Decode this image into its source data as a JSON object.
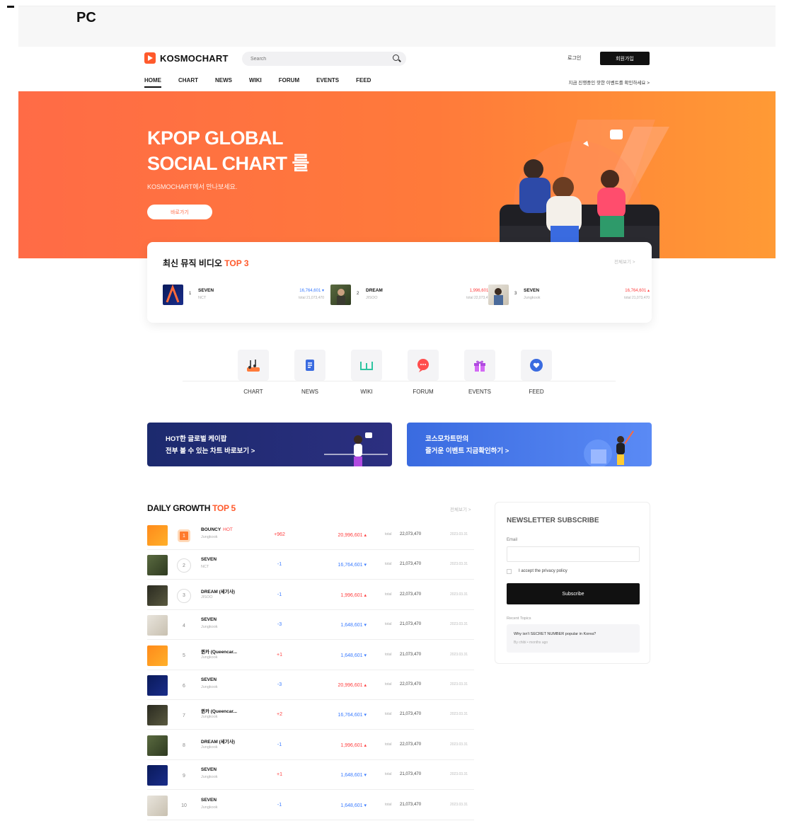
{
  "frame": {
    "label": "PC"
  },
  "header": {
    "logo": "KOSMOCHART",
    "search_placeholder": "Search",
    "login": "로그인",
    "join": "회원가입",
    "nav": [
      "HOME",
      "CHART",
      "NEWS",
      "WIKI",
      "FORUM",
      "EVENTS",
      "FEED"
    ],
    "active_nav": "HOME",
    "nav_note": "지금 진행중인 핫한 이벤트를 확인하세요 >"
  },
  "hero": {
    "title": "KPOP GLOBAL\nSOCIAL CHART 를",
    "subtitle": "KOSMOCHART에서 만나보세요.",
    "button": "바로가기"
  },
  "top3": {
    "title_prefix": "최신 뮤직 비디오 ",
    "title_highlight": "TOP 3",
    "view_all": "전체보기 >",
    "items": [
      {
        "rank": "1",
        "name": "SEVEN",
        "artist": "NCT",
        "value": "16,764,601 ▾",
        "total": "total  21,073,470",
        "color": "#3a7bff"
      },
      {
        "rank": "2",
        "name": "DREAM",
        "artist": "JISOO",
        "value": "1,996,601 ▴",
        "total": "total  22,073,470",
        "color": "#ff4040"
      },
      {
        "rank": "3",
        "name": "SEVEN",
        "artist": "Jungkook",
        "value": "16,764,601 ▴",
        "total": "total  21,073,470",
        "color": "#ff4040"
      }
    ]
  },
  "categories": [
    {
      "label": "CHART",
      "icon": "music-notes-icon"
    },
    {
      "label": "NEWS",
      "icon": "newspaper-icon"
    },
    {
      "label": "WIKI",
      "icon": "book-icon"
    },
    {
      "label": "FORUM",
      "icon": "chat-bubble-icon"
    },
    {
      "label": "EVENTS",
      "icon": "gift-icon"
    },
    {
      "label": "FEED",
      "icon": "heart-icon"
    }
  ],
  "banners": [
    {
      "line1": "HOT한 글로벌 케이팝",
      "line2": "전부 볼 수 있는 차트 바로보기 >"
    },
    {
      "line1": "코스모차트만의",
      "line2": "즐거운 이벤트 지금확인하기 >"
    }
  ],
  "daily_growth": {
    "title_prefix": "DAILY GROWTH ",
    "title_highlight": "TOP 5",
    "view_all": "전체보기 >",
    "rows": [
      {
        "rank": "1",
        "name": "BOUNCY",
        "hot": "HOT",
        "artist": "Jungkook",
        "change": "+962",
        "value": "20,996,601 ▴",
        "total_label": "total",
        "total": "22,073,470",
        "date": "2023.03.31",
        "change_color": "#ff4040",
        "value_color": "#ff4040"
      },
      {
        "rank": "2",
        "name": "SEVEN",
        "hot": "",
        "artist": "NCT",
        "change": "-1",
        "value": "16,764,601 ▾",
        "total_label": "total",
        "total": "21,073,470",
        "date": "2023.03.31",
        "change_color": "#3a7bff",
        "value_color": "#3a7bff"
      },
      {
        "rank": "3",
        "name": "DREAM (세기사)",
        "hot": "",
        "artist": "JISOO",
        "change": "-1",
        "value": "1,996,601 ▴",
        "total_label": "total",
        "total": "22,073,470",
        "date": "2023.03.31",
        "change_color": "#3a7bff",
        "value_color": "#ff4040"
      },
      {
        "rank": "4",
        "name": "SEVEN",
        "hot": "",
        "artist": "Jungkook",
        "change": "-3",
        "value": "1,648,601 ▾",
        "total_label": "total",
        "total": "21,073,470",
        "date": "2023.03.31",
        "change_color": "#3a7bff",
        "value_color": "#3a7bff"
      },
      {
        "rank": "5",
        "name": "퀸카 (Queencar...",
        "hot": "",
        "artist": "Jungkook",
        "change": "+1",
        "value": "1,648,601 ▾",
        "total_label": "total",
        "total": "21,073,470",
        "date": "2023.03.31",
        "change_color": "#ff4040",
        "value_color": "#3a7bff"
      },
      {
        "rank": "6",
        "name": "SEVEN",
        "hot": "",
        "artist": "Jungkook",
        "change": "-3",
        "value": "20,996,601 ▴",
        "total_label": "total",
        "total": "22,073,470",
        "date": "2023.03.31",
        "change_color": "#3a7bff",
        "value_color": "#ff4040"
      },
      {
        "rank": "7",
        "name": "퀸카 (Queencar...",
        "hot": "",
        "artist": "Jungkook",
        "change": "+2",
        "value": "16,764,601 ▾",
        "total_label": "total",
        "total": "21,073,470",
        "date": "2023.03.31",
        "change_color": "#ff4040",
        "value_color": "#3a7bff"
      },
      {
        "rank": "8",
        "name": "DREAM (세기사)",
        "hot": "",
        "artist": "Jungkook",
        "change": "-1",
        "value": "1,996,601 ▴",
        "total_label": "total",
        "total": "22,073,470",
        "date": "2023.03.31",
        "change_color": "#3a7bff",
        "value_color": "#ff4040"
      },
      {
        "rank": "9",
        "name": "SEVEN",
        "hot": "",
        "artist": "Jungkook",
        "change": "+1",
        "value": "1,648,601 ▾",
        "total_label": "total",
        "total": "21,073,470",
        "date": "2023.03.31",
        "change_color": "#ff4040",
        "value_color": "#3a7bff"
      },
      {
        "rank": "10",
        "name": "SEVEN",
        "hot": "",
        "artist": "Jungkook",
        "change": "-1",
        "value": "1,648,601 ▾",
        "total_label": "total",
        "total": "21,073,470",
        "date": "2023.03.31",
        "change_color": "#3a7bff",
        "value_color": "#3a7bff"
      }
    ]
  },
  "newsletter": {
    "title": "NEWSLETTER SUBSCRIBE",
    "email_label": "Email",
    "checkbox_label": "I accept the privacy policy",
    "button": "Subscribe",
    "recent_label": "Recent Topics",
    "topic_question": "Why isn't SECRET NUMBER popular in Korea?",
    "topic_by": "By chibi • months ago"
  },
  "colors": {
    "accent": "#ff5a2c",
    "up": "#ff4040",
    "down": "#3a7bff"
  }
}
